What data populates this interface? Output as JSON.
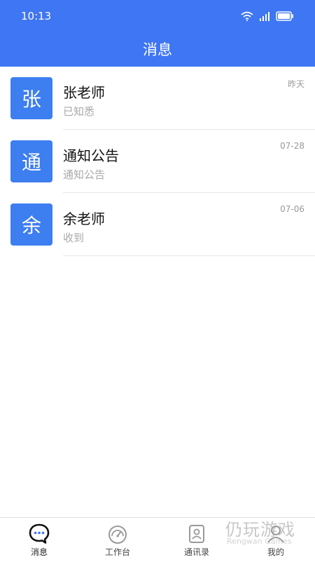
{
  "status_bar": {
    "time": "10:13"
  },
  "header": {
    "title": "消息"
  },
  "messages": [
    {
      "avatar_char": "张",
      "name": "张老师",
      "preview": "已知悉",
      "time": "昨天"
    },
    {
      "avatar_char": "通",
      "name": "通知公告",
      "preview": "通知公告",
      "time": "07-28"
    },
    {
      "avatar_char": "余",
      "name": "余老师",
      "preview": "收到",
      "time": "07-06"
    }
  ],
  "tabs": [
    {
      "label": "消息",
      "icon": "chat-bubble-icon",
      "active": true
    },
    {
      "label": "工作台",
      "icon": "gauge-icon",
      "active": false
    },
    {
      "label": "通讯录",
      "icon": "contacts-icon",
      "active": false
    },
    {
      "label": "我的",
      "icon": "person-icon",
      "active": false
    }
  ],
  "watermark": {
    "main": "仍玩游戏",
    "sub": "Rengwan Games"
  },
  "colors": {
    "primary": "#3f76f3",
    "avatar": "#3d7ef0"
  }
}
